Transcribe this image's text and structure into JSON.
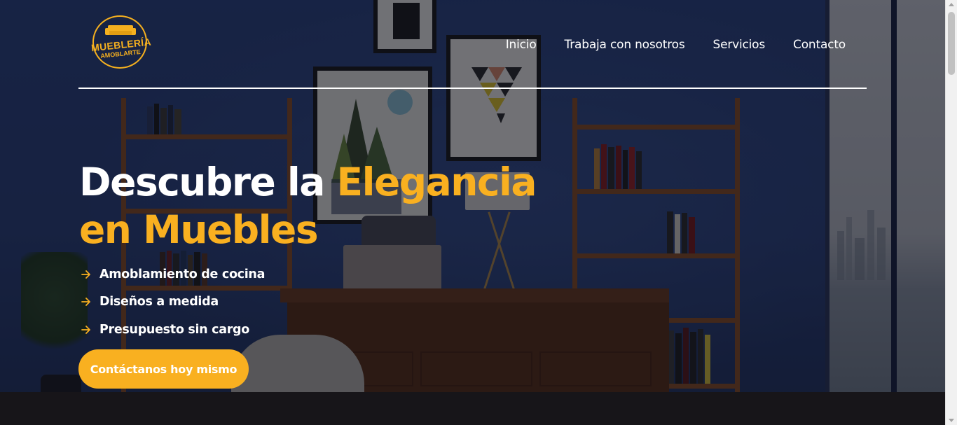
{
  "brand": {
    "logo_line1": "MUEBLERÍA",
    "logo_line2": "AMOBLARTE",
    "accent_color": "#f9b020"
  },
  "nav": {
    "items": [
      {
        "label": "Inicio"
      },
      {
        "label": "Trabaja con nosotros"
      },
      {
        "label": "Servicios"
      },
      {
        "label": "Contacto"
      }
    ]
  },
  "hero": {
    "title_part1": "Descubre la ",
    "title_accent1": "Elegancia",
    "title_accent2": "en Muebles",
    "features": [
      {
        "label": "Amoblamiento de cocina",
        "icon": "arrow-right-icon"
      },
      {
        "label": "Diseños a medida",
        "icon": "arrow-right-icon"
      },
      {
        "label": "Presupuesto sin cargo",
        "icon": "arrow-right-icon"
      }
    ],
    "cta_label": "Contáctanos hoy mismo"
  }
}
